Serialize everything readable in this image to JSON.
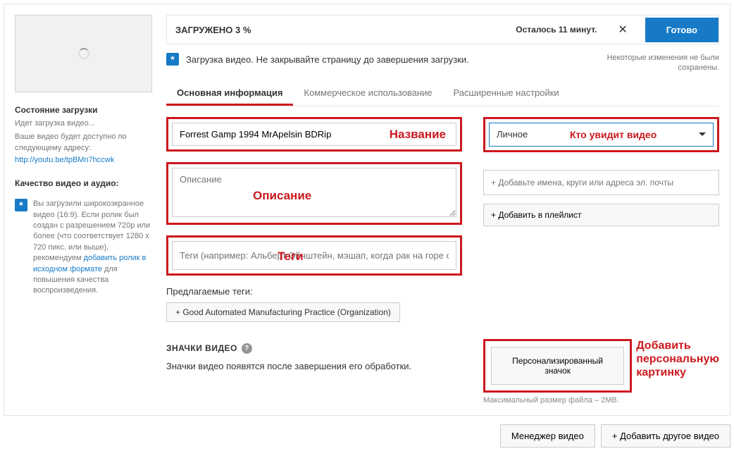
{
  "upload": {
    "progress_label": "ЗАГРУЖЕНО 3 %",
    "remaining": "Осталось 11 минут.",
    "done_btn": "Готово",
    "status_msg": "Загрузка видео. Не закрывайте страницу до завершения загрузки.",
    "changes_line1": "Некоторые изменения не были",
    "changes_line2": "сохранены."
  },
  "tabs": {
    "basic": "Основная информация",
    "commercial": "Коммерческое использование",
    "advanced": "Расширенные настройки"
  },
  "fields": {
    "title_value": "Forrest Gamp 1994 MrApelsin BDRip",
    "title_annot": "Название",
    "desc_placeholder": "Описание",
    "desc_annot": "Описание",
    "tags_placeholder": "Теги (например: Альберт Эйнштейн, мэшап, когда рак на горе сви",
    "tags_annot": "Теги",
    "suggested_label": "Предлагаемые теги:",
    "suggested_chip": "+ Good Automated Manufacturing Practice (Organization)"
  },
  "privacy": {
    "value": "Личное",
    "annot": "Кто увидит видео",
    "share_placeholder": "+ Добавьте имена, круги или адреса эл. почты",
    "playlist_btn": "+ Добавить в плейлист"
  },
  "thumbs": {
    "header": "ЗНАЧКИ ВИДЕО",
    "info": "Значки видео появятся после завершения его обработки.",
    "custom_btn": "Персонализированный значок",
    "hint": "Максимальный размер файла – 2MB.",
    "annot1": "Добавить",
    "annot2": "персональную",
    "annot3": "картинку"
  },
  "left": {
    "status_title": "Состояние загрузки",
    "status_text": "Идет загрузка видео...",
    "url_intro1": "Ваше видео будет доступно по",
    "url_intro2": "следующему адресу:",
    "url": "http://youtu.be/tpBMn7hccwk",
    "quality_title": "Качество видео и аудио:",
    "quality_p1": "Вы загрузили широкоэкранное видео (16:9). Если ролик был создан с разрешением 720p или более (что соответствует 1280 x 720 пикс. или выше), рекомендуем ",
    "quality_link": "добавить ролик в исходном формате",
    "quality_p2": " для повышения качества воспроизведения."
  },
  "footer": {
    "manager": "Менеджер видео",
    "add_another": "+  Добавить другое видео"
  }
}
